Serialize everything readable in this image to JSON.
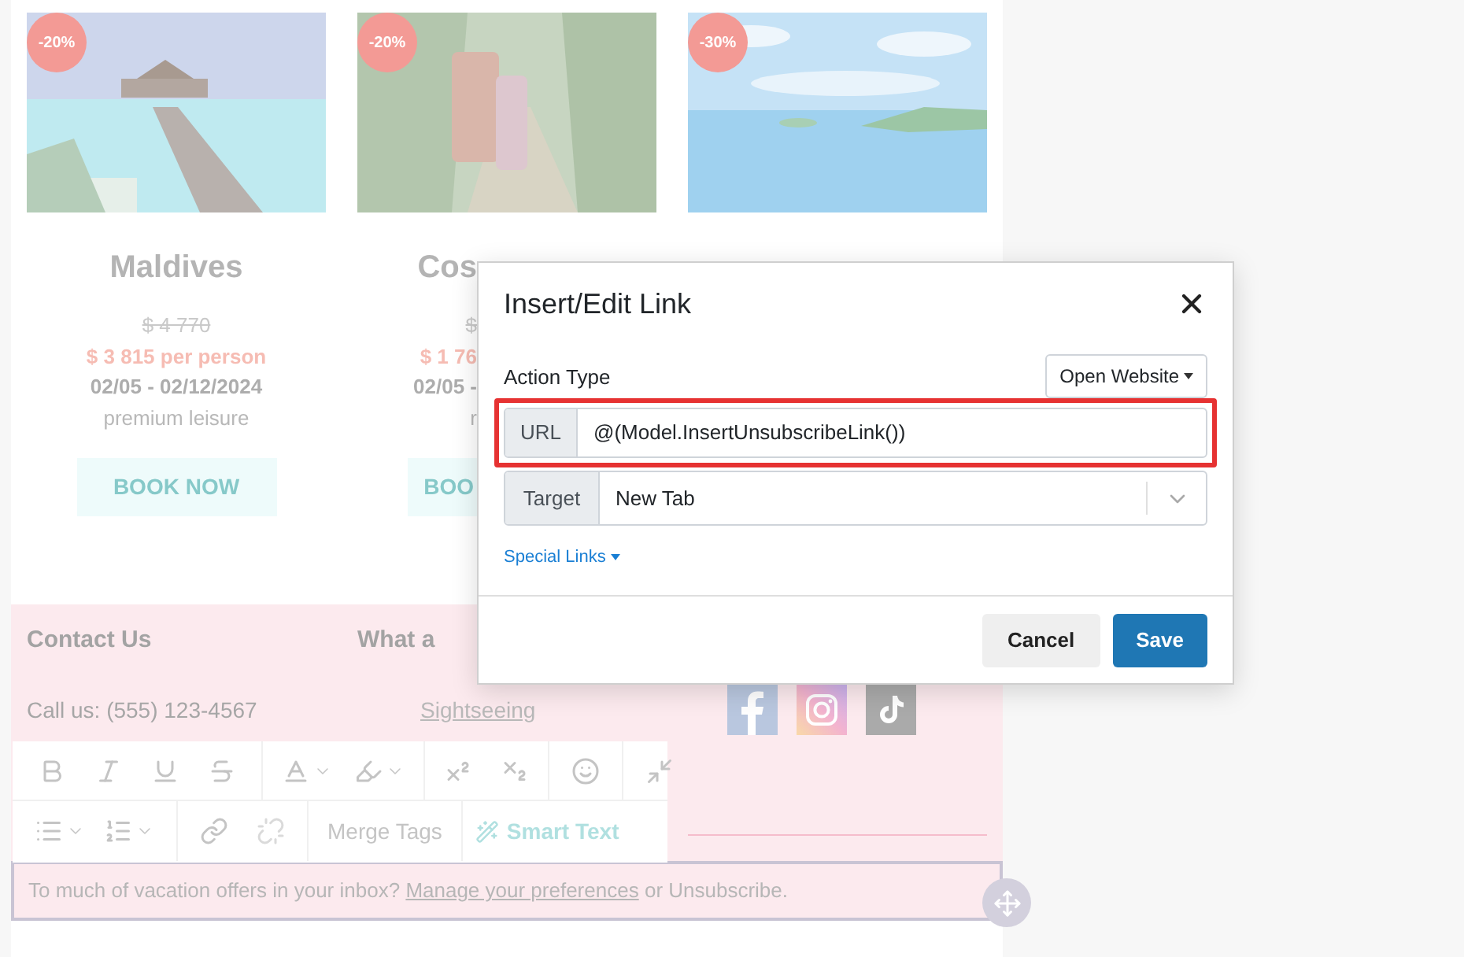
{
  "cards": [
    {
      "discount": "-20%",
      "title": "Maldives",
      "old_price": "$ 4 770",
      "price": "$ 3 815 per person",
      "dates": "02/05 - 02/12/2024",
      "tag": "premium leisure",
      "button": "BOOK NOW"
    },
    {
      "discount": "-20%",
      "title": "Cos",
      "old_price": "$",
      "price": "$ 1 76",
      "dates": "02/05 -",
      "tag": "r",
      "button": "BOO"
    },
    {
      "discount": "-30%"
    }
  ],
  "footer": {
    "columns": [
      {
        "heading": "Contact Us",
        "line": "Call us: (555) 123-4567"
      },
      {
        "heading": "What a",
        "link": "Sightseeing"
      }
    ],
    "notice": {
      "text": "To much of vacation offers in your inbox?",
      "link": "Manage your preferences",
      "after": "or Unsubscribe."
    }
  },
  "toolbar": {
    "merge_tags": "Merge Tags",
    "smart_text": "Smart Text"
  },
  "dialog": {
    "title": "Insert/Edit Link",
    "action_type_label": "Action Type",
    "action_type": "Open Website",
    "url_label": "URL",
    "url": "@(Model.InsertUnsubscribeLink())",
    "target_label": "Target",
    "target": "New Tab",
    "special_links": "Special Links",
    "buttons": [
      "Cancel",
      "Save"
    ]
  }
}
